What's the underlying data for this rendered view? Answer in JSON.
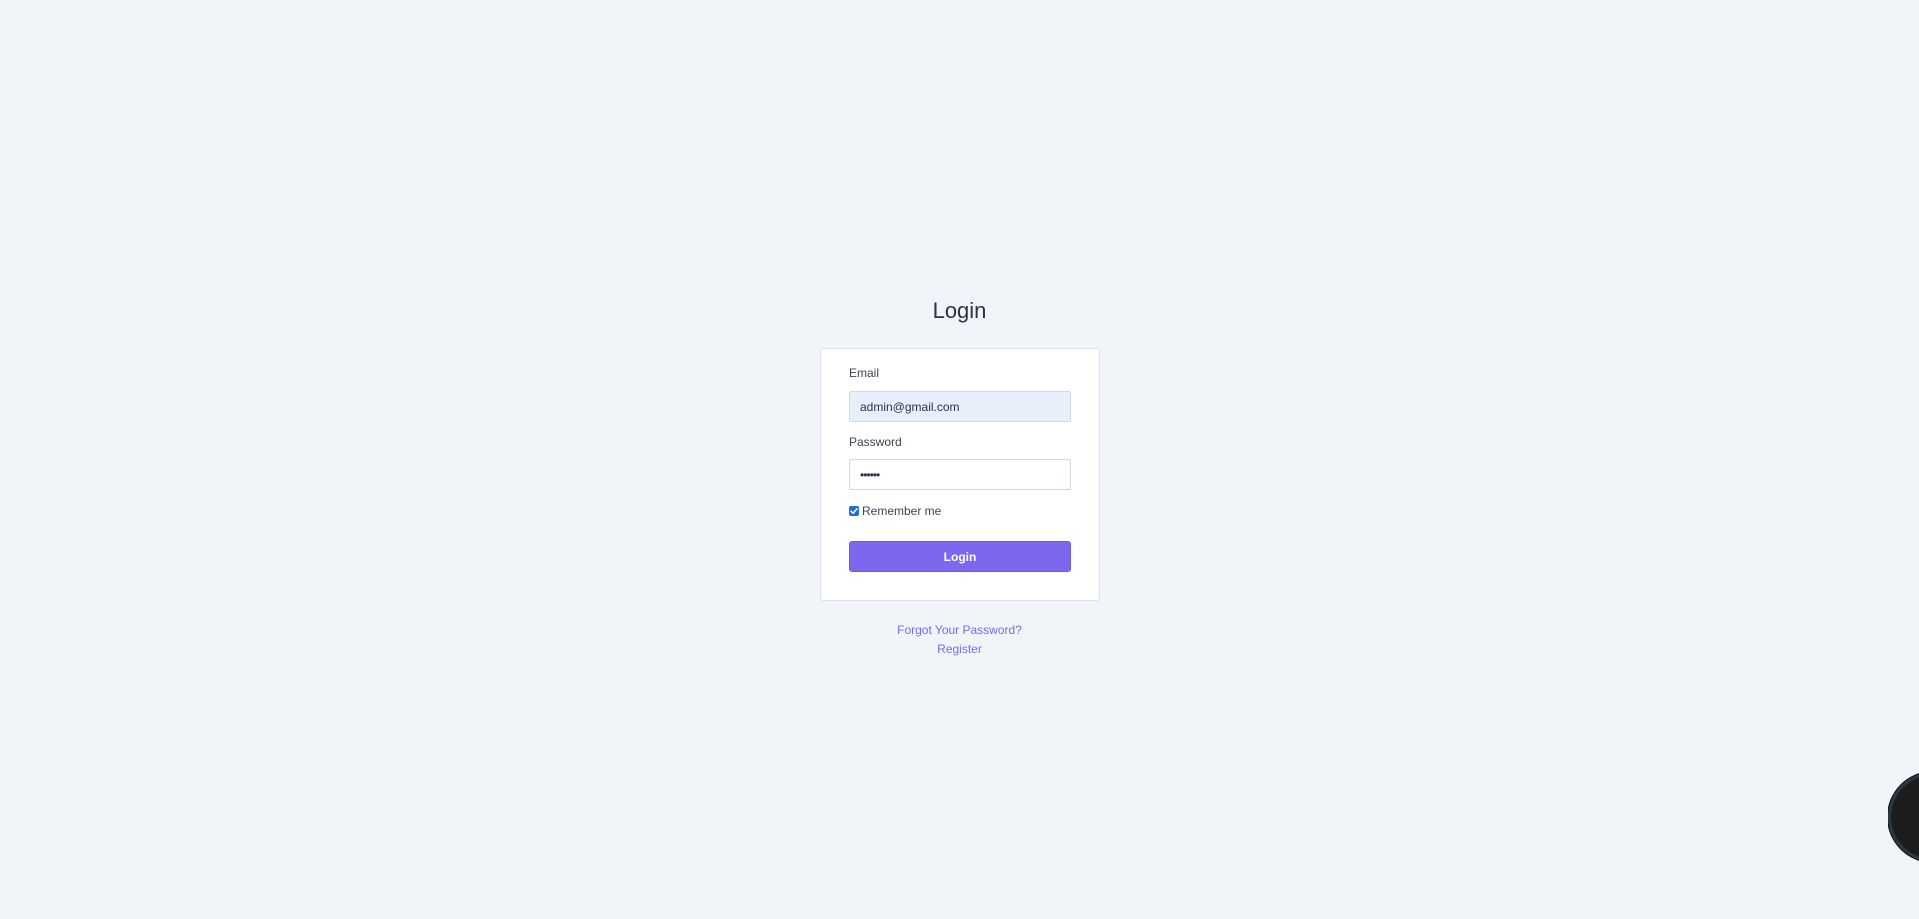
{
  "page": {
    "title": "Login"
  },
  "form": {
    "email_label": "Email",
    "email_value": "admin@gmail.com",
    "password_label": "Password",
    "password_value": "••••••",
    "remember_label": "Remember me",
    "remember_checked": true,
    "submit_label": "Login"
  },
  "links": {
    "forgot_password": "Forgot Your Password?",
    "register": "Register"
  },
  "colors": {
    "accent": "#7b68ee",
    "background": "#f1f4f8",
    "checkbox": "#1e6fd9"
  },
  "icons": {
    "remember_checkbox": "checkmark-icon",
    "floating_badge": "floating-action-icon"
  }
}
